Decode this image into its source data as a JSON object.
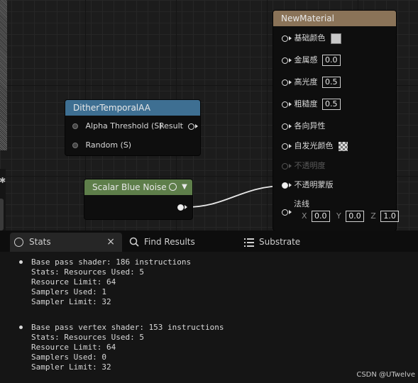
{
  "nodes": {
    "new_material": {
      "title": "NewMaterial",
      "pins": {
        "base_color": "基础颜色",
        "metallic": {
          "label": "金属感",
          "value": "0.0"
        },
        "specular": {
          "label": "高光度",
          "value": "0.5"
        },
        "roughness": {
          "label": "粗糙度",
          "value": "0.5"
        },
        "anisotropy": "各向异性",
        "emissive_color": "自发光颜色",
        "opacity": "不透明度",
        "opacity_mask": "不透明蒙版",
        "normal": {
          "label": "法线",
          "x_label": "X",
          "x": "0.0",
          "y_label": "Y",
          "y": "0.0",
          "z_label": "Z",
          "z": "1.0"
        }
      }
    },
    "dither": {
      "title": "DitherTemporalAA",
      "inputs": [
        "Alpha Threshold (S)",
        "Random (S)"
      ],
      "output": "Result"
    },
    "blue_noise": {
      "title": "Scalar Blue Noise"
    }
  },
  "panel": {
    "tabs": [
      {
        "label": "Stats",
        "icon": "stats-icon",
        "close": "×"
      },
      {
        "label": "Find Results",
        "icon": "search-icon"
      },
      {
        "label": "Substrate",
        "icon": "list-icon"
      }
    ],
    "stats": [
      {
        "heading": "Base pass shader: 186 instructions",
        "lines": [
          "Stats: Resources Used: 5",
          "Resource Limit: 64",
          "Samplers Used: 1",
          "Sampler Limit: 32"
        ]
      },
      {
        "heading": "Base pass vertex shader: 153 instructions",
        "lines": [
          "Stats: Resources Used: 5",
          "Resource Limit: 64",
          "Samplers Used: 0",
          "Sampler Limit: 32"
        ]
      }
    ]
  },
  "watermark": "CSDN @UTwelve",
  "colors": {
    "material_header": "#8a7358",
    "dither_header": "#3e6f92",
    "noise_header": "#5e7e4a"
  }
}
